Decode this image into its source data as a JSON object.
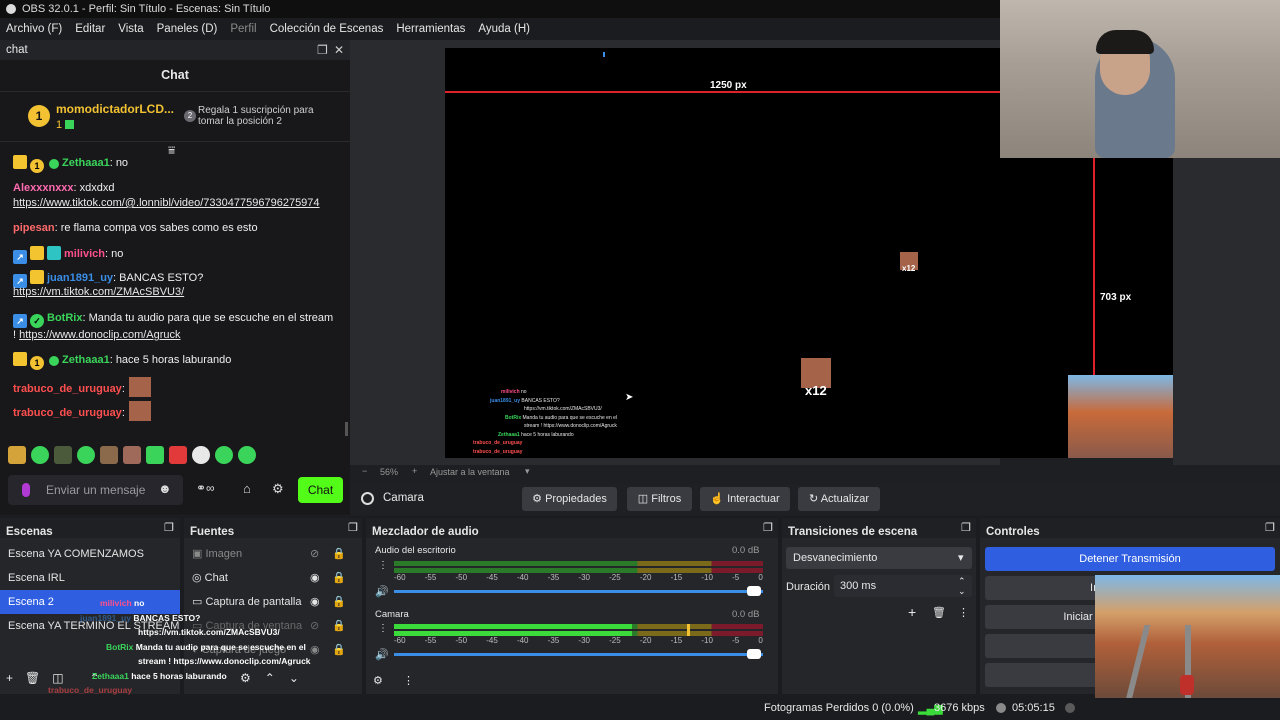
{
  "window": {
    "title": "OBS 32.0.1 - Perfil: Sin Título - Escenas: Sin Título"
  },
  "menu": [
    "Archivo (F)",
    "Editar",
    "Vista",
    "Paneles (D)",
    "Perfil",
    "Colección de Escenas",
    "Herramientas",
    "Ayuda (H)"
  ],
  "chat_dock": {
    "dock_title": "chat",
    "panel_title": "Chat",
    "pinned_user": "momodictadorLCD...",
    "pinned_count": "1",
    "pinned_position_badge": "2",
    "pinned_text": "Regala 1 suscripción para tomar la posición 2",
    "messages": [
      {
        "user": "Zethaaa1",
        "text": ": no",
        "user_color": "#3ad45a"
      },
      {
        "user": "Alexxxnxxx",
        "text": ": xdxdxd",
        "user_color": "#ff6ab0"
      },
      {
        "link": "https://www.tiktok.com/@.lonnibl/video/7330477596796275974"
      },
      {
        "user": "pipesan",
        "text": ": re flama compa vos sabes como es esto",
        "user_color": "#ff6a6a"
      },
      {
        "user": "milivich",
        "text": ": no",
        "user_color": "#ff4f8b"
      },
      {
        "user": "juan1891_uy",
        "text": ": BANCAS ESTO?",
        "user_color": "#3a8ee6"
      },
      {
        "link": "https://vm.tiktok.com/ZMAcSBVU3/"
      },
      {
        "user": "BotRix",
        "text": ": Manda tu audio para que se escuche en el stream",
        "user_color": "#3ad45a"
      },
      {
        "text_prefix": "! ",
        "link": "https://www.donoclip.com/Agruck"
      },
      {
        "user": "Zethaaa1",
        "text": ": hace 5 horas laburando",
        "user_color": "#3ad45a"
      },
      {
        "user": "trabuco_de_uruguay",
        "text": ":",
        "user_color": "#ff4f4f"
      },
      {
        "user": "trabuco_de_uruguay",
        "text": ":",
        "user_color": "#ff4f4f"
      }
    ],
    "input_placeholder": "Enviar un mensaje",
    "send_label": "Chat"
  },
  "preview": {
    "width_label": "1250 px",
    "height_label": "703 px",
    "emote_count_1": "x12",
    "emote_count_2": "x12",
    "zoom": "56%",
    "fit_label": "Ajustar a la ventana",
    "overlay_chat": [
      {
        "user": "milivich",
        "text": "no"
      },
      {
        "user": "juan1891_uy",
        "text": "BANCAS ESTO?"
      },
      {
        "user": "",
        "text": "https://vm.tiktok.com/ZMAcSBVU3/"
      },
      {
        "user": "BotRix",
        "text": "Manda tu audio para que se escuche en el"
      },
      {
        "user": "",
        "text": "stream ! https://www.donoclip.com/Agruck"
      },
      {
        "user": "Zethaaa1",
        "text": "hace 5 horas laburando"
      },
      {
        "user": "trabuco_de_uruguay",
        "text": ""
      },
      {
        "user": "trabuco_de_uruguay",
        "text": ""
      }
    ]
  },
  "source_toolbar": {
    "source_name": "Camara",
    "properties": "Propiedades",
    "filters": "Filtros",
    "interact": "Interactuar",
    "refresh": "Actualizar"
  },
  "scenes": {
    "title": "Escenas",
    "items": [
      "Escena YA COMENZAMOS",
      "Escena IRL",
      "Escena 2",
      "Escena YA TERMINO EL STREAM"
    ],
    "selected_index": 2
  },
  "sources": {
    "title": "Fuentes",
    "items": [
      "Imagen",
      "Chat",
      "Captura de pantalla",
      "Captura de ventana",
      "Captura de juego"
    ]
  },
  "mixer": {
    "title": "Mezclador de audio",
    "channels": [
      {
        "name": "Audio del escritorio",
        "db": "0.0 dB",
        "level_fraction": 0.0
      },
      {
        "name": "Camara",
        "db": "0.0 dB",
        "level_fraction": 0.62
      }
    ],
    "ticks": [
      "-60",
      "-55",
      "-50",
      "-45",
      "-40",
      "-35",
      "-30",
      "-25",
      "-20",
      "-15",
      "-10",
      "-5",
      "0"
    ]
  },
  "transitions": {
    "title": "Transiciones de escena",
    "selected": "Desvanecimiento",
    "duration_label": "Duración",
    "duration_value": "300 ms"
  },
  "controls": {
    "title": "Controles",
    "stop_stream": "Detener Transmisión",
    "start_label_partial_1": "Iı",
    "start_label_partial_2": "Iniciar"
  },
  "status": {
    "dropped": "Fotogramas Perdidos 0 (0.0%)",
    "bitrate": "3676 kbps",
    "time": "05:05:15"
  },
  "colors": {
    "accent_blue": "#2f5fe0",
    "kick_green": "#53fc18",
    "guide_red": "#e0202a"
  }
}
